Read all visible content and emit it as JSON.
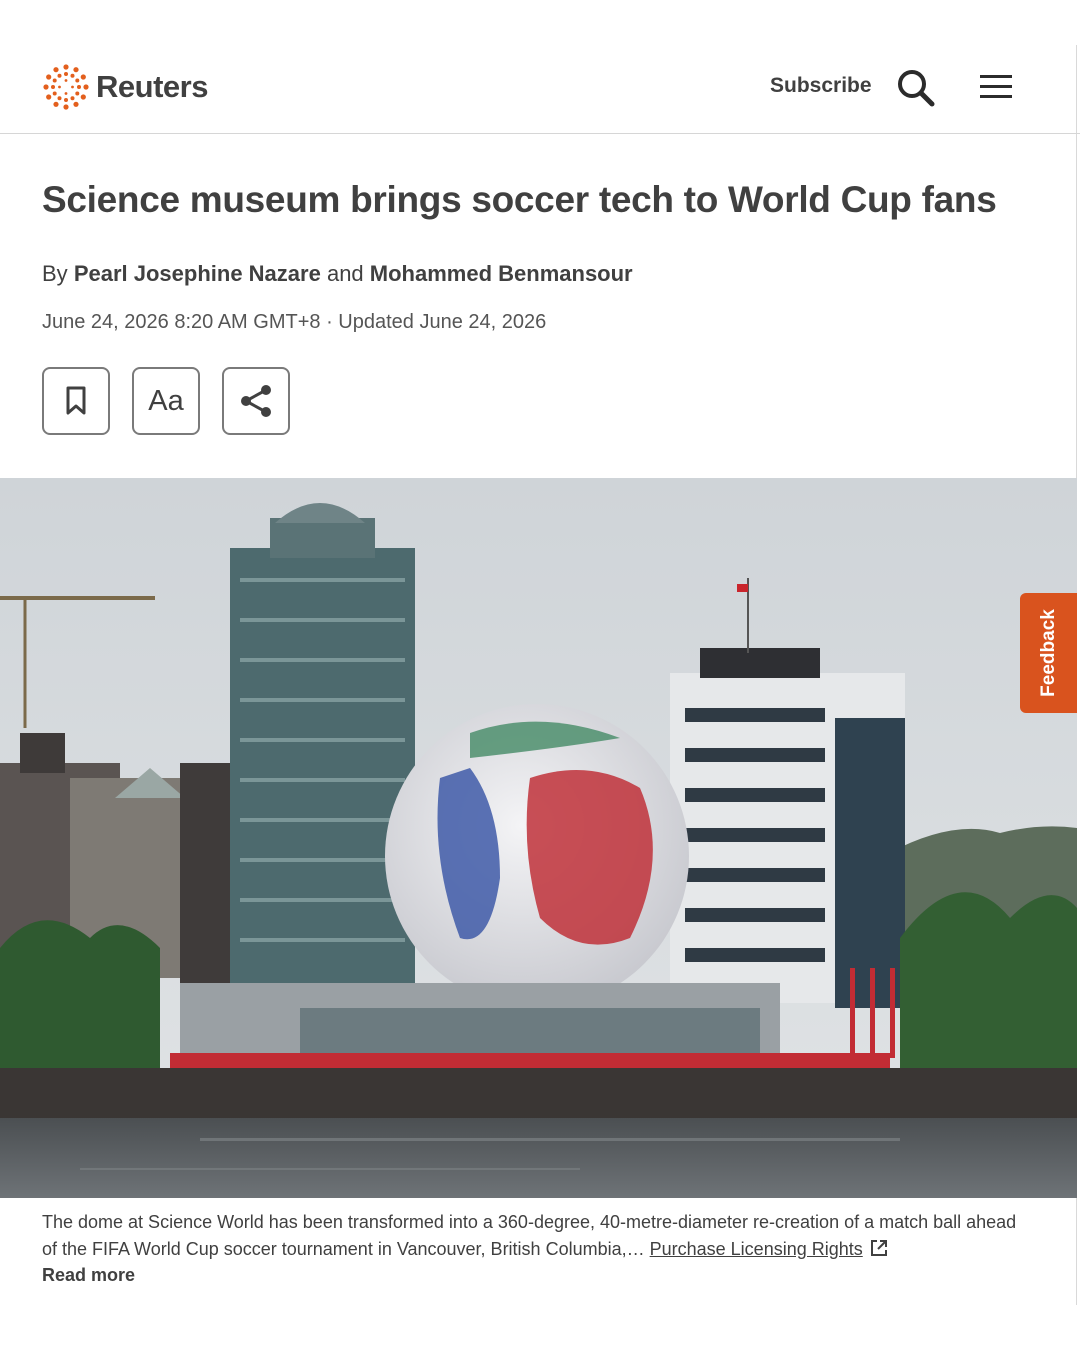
{
  "header": {
    "logo_text": "Reuters",
    "subscribe_label": "Subscribe",
    "search_icon": "search-icon",
    "menu_icon": "hamburger-menu-icon"
  },
  "article": {
    "headline": "Science museum brings soccer tech to World Cup fans",
    "byline_prefix": "By",
    "author_1": "Pearl Josephine Nazare",
    "byline_joiner": "and",
    "author_2": "Mohammed Benmansour",
    "dateline": "June 24, 2026 8:20 AM GMT+8 · Updated June 24, 2026"
  },
  "tools": {
    "bookmark_icon": "bookmark-icon",
    "font_size_label": "Aa",
    "share_icon": "share-icon"
  },
  "photo": {
    "caption": "The dome at Science World has been transformed into a 360-degree, 40-metre-diameter re-creation of a match ball ahead of the FIFA World Cup soccer tournament in Vancouver, British Columbia,…",
    "licensing_link": "Purchase Licensing Rights",
    "external_link_icon": "external-link-icon",
    "read_more": "Read more"
  },
  "feedback_label": "Feedback",
  "colors": {
    "brand_orange": "#d9531e",
    "text_dark": "#404040",
    "sky": "#d4d8dc"
  }
}
